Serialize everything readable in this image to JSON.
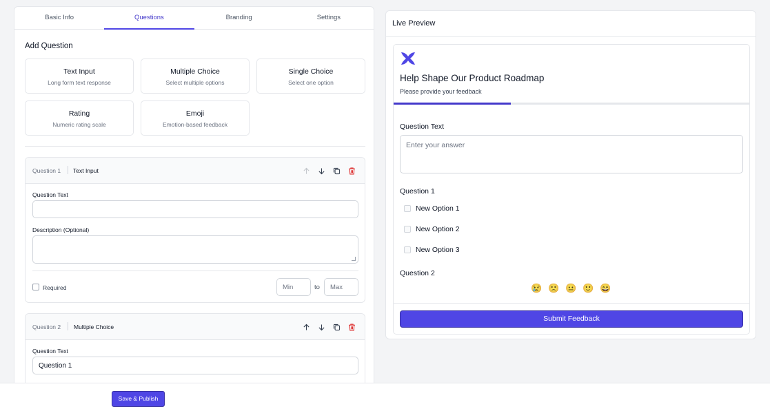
{
  "tabs": [
    "Basic Info",
    "Questions",
    "Branding",
    "Settings"
  ],
  "editor": {
    "add_question_title": "Add Question",
    "types": [
      {
        "title": "Text Input",
        "desc": "Long form text response"
      },
      {
        "title": "Multiple Choice",
        "desc": "Select multiple options"
      },
      {
        "title": "Single Choice",
        "desc": "Select one option"
      },
      {
        "title": "Rating",
        "desc": "Numeric rating scale"
      },
      {
        "title": "Emoji",
        "desc": "Emotion-based feedback"
      }
    ],
    "q1": {
      "number": "Question 1",
      "type": "Text Input",
      "text_label": "Question Text",
      "text_value": "",
      "desc_label": "Description (Optional)",
      "required_label": "Required",
      "min_placeholder": "Min",
      "to_label": "to",
      "max_placeholder": "Max"
    },
    "q2": {
      "number": "Question 2",
      "type": "Multiple Choice",
      "text_label": "Question Text",
      "text_value": "Question 1"
    }
  },
  "publish_label": "Save & Publish",
  "preview": {
    "title": "Live Preview",
    "form_title": "Help Shape Our Product Roadmap",
    "form_subtitle": "Please provide your feedback",
    "progress": 0.33,
    "q_text_label": "Question Text",
    "answer_placeholder": "Enter your answer",
    "q1_label": "Question 1",
    "options": [
      "New Option 1",
      "New Option 2",
      "New Option 3"
    ],
    "q2_label": "Question 2",
    "emojis": [
      "😢",
      "🙁",
      "😐",
      "🙂",
      "😄"
    ],
    "submit_label": "Submit Feedback"
  },
  "colors": {
    "accent": "#4f46e5",
    "danger": "#dc2626"
  }
}
